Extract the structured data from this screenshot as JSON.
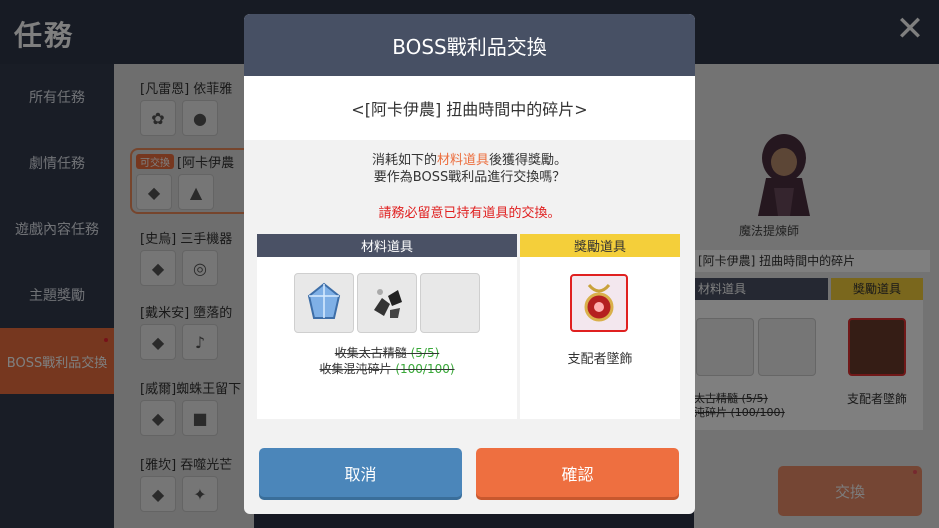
{
  "header": {
    "title": "任務",
    "close_icon": "close-icon"
  },
  "sidebar": {
    "items": [
      {
        "label": "所有任務",
        "active": false
      },
      {
        "label": "劇情任務",
        "active": false
      },
      {
        "label": "遊戲內容任務",
        "active": false
      },
      {
        "label": "主題獎勵",
        "active": false
      },
      {
        "label": "BOSS戰利品交換",
        "active": true
      }
    ]
  },
  "quests": [
    {
      "label": "[凡雷恩] 依菲雅"
    },
    {
      "badge": "可交換",
      "label": "[阿卡伊農"
    },
    {
      "label": "[史烏] 三手機器"
    },
    {
      "label": "[戴米安] 墮落的"
    },
    {
      "label": "[威爾]蜘蛛王留下"
    },
    {
      "label": "[雅坎] 吞噬光芒"
    }
  ],
  "detail": {
    "npc_name": "魔法提煉師",
    "quest_title": "[阿卡伊農] 扭曲時間中的碎片",
    "material_header": "材料道具",
    "reward_header": "獎勵道具",
    "req1": "太古精髓 (5/5)",
    "req2": "沌碎片 (100/100)",
    "reward_name": "支配者墜飾",
    "exchange_button": "交換"
  },
  "modal": {
    "title": "BOSS戰利品交換",
    "subtitle": "<[阿卡伊農] 扭曲時間中的碎片>",
    "desc_part1": "消耗如下的",
    "desc_highlight": "材料道具",
    "desc_part2": "後獲得獎勵。",
    "desc_line2": "要作為BOSS戰利品進行交換嗎？",
    "warning": "請務必留意已持有道具的交換。",
    "material_header": "材料道具",
    "reward_header": "獎勵道具",
    "requirements": [
      {
        "text": "收集太古精髓",
        "count": "(5/5)"
      },
      {
        "text": "收集混沌碎片",
        "count": "(100/100)"
      }
    ],
    "reward_name": "支配者墜飾",
    "cancel": "取消",
    "confirm": "確認"
  },
  "colors": {
    "accent": "#ec6e3e",
    "header": "#475064",
    "cancel": "#4b86ba",
    "reward_header": "#f4cf3a",
    "warning": "#e02020"
  }
}
